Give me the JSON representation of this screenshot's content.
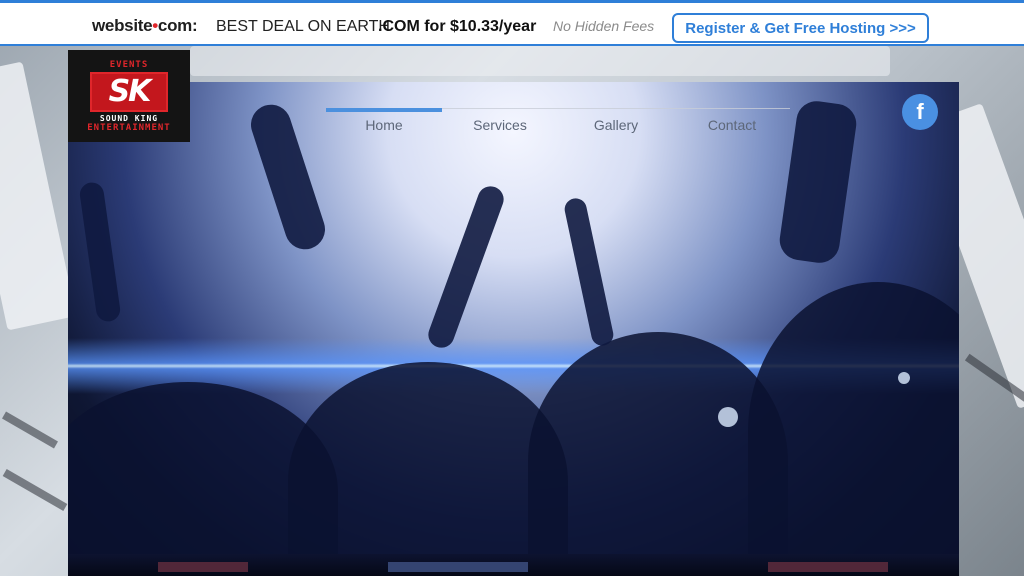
{
  "promo_bar": {
    "brand_name": "website",
    "brand_tld": "com",
    "deal_text": "BEST DEAL ON EARTH",
    "com_offer": ".COM for $10.33/year",
    "no_hidden_fees": "No Hidden Fees",
    "register_button": "Register & Get Free Hosting >>>",
    "accent_color": "#2f7fd8"
  },
  "logo": {
    "top_text": "EVENTS",
    "mark_text": "SK",
    "name_text": "SOUND KING",
    "bottom_text": "ENTERTAINMENT",
    "brand_color": "#e0262b"
  },
  "nav": {
    "items": [
      {
        "label": "Home",
        "active": true
      },
      {
        "label": "Services",
        "active": false
      },
      {
        "label": "Gallery",
        "active": false
      },
      {
        "label": "Contact",
        "active": false
      }
    ]
  },
  "social": {
    "facebook_glyph": "f",
    "facebook_icon": "facebook-icon",
    "facebook_color": "#4a90e2"
  }
}
